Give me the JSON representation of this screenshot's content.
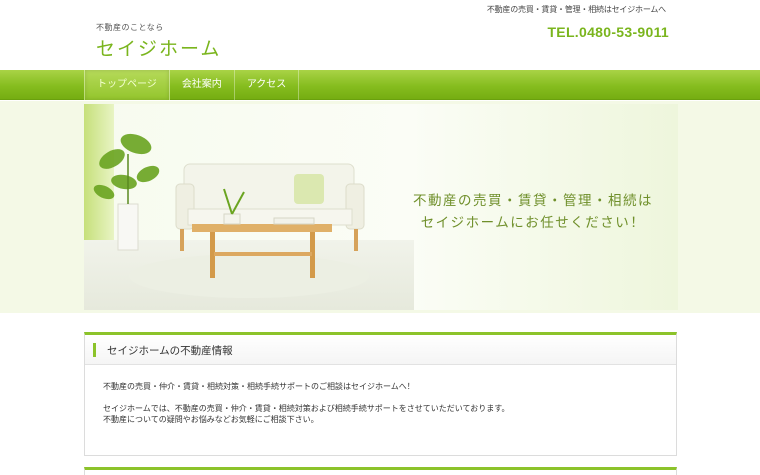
{
  "header": {
    "tagline": "不動産の売買・賃貸・管理・相続はセイジホームへ",
    "logo_sub": "不動産のことなら",
    "logo_main": "セイジホーム",
    "tel": "TEL.0480-53-9011"
  },
  "nav": {
    "items": [
      {
        "label": "トップページ",
        "active": true
      },
      {
        "label": "会社案内",
        "active": false
      },
      {
        "label": "アクセス",
        "active": false
      }
    ]
  },
  "hero": {
    "line1": "不動産の売買・賃貸・管理・相続は",
    "line2": "セイジホームにお任せください！"
  },
  "section": {
    "title": "セイジホームの不動産情報",
    "para1": "不動産の売買・仲介・賃貸・相続対策・相続手続サポートのご相談はセイジホームへ！",
    "para2": "セイジホームでは、不動産の売買・仲介・賃貸・相続対策および相続手続サポートをさせていただいております。",
    "para3": "不動産についての疑問やお悩みなどお気軽にご相談下さい。"
  },
  "colors": {
    "accent": "#8cc32a",
    "logo": "#7ab51d",
    "hero_text": "#6f8f2a"
  }
}
